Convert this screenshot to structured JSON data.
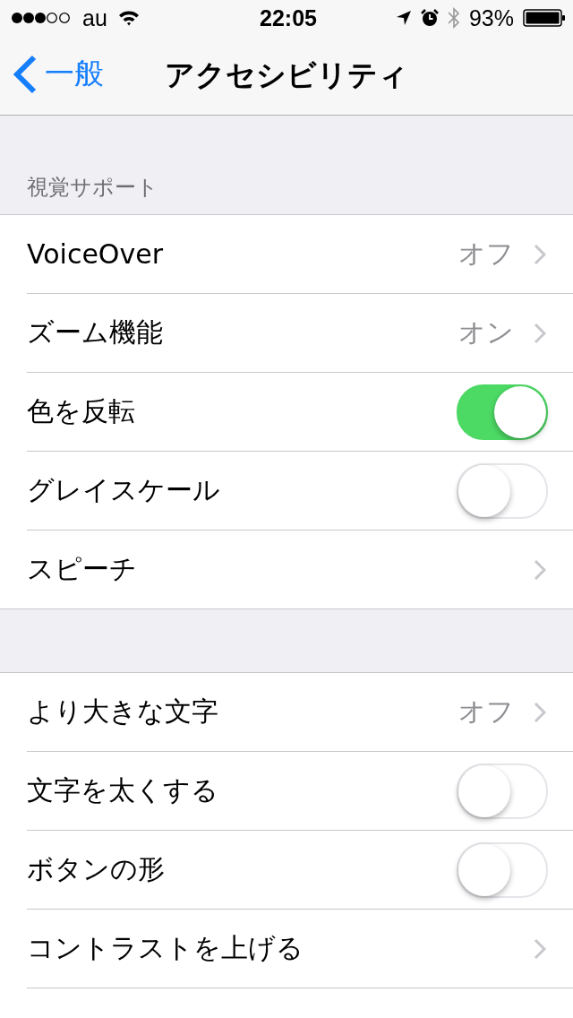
{
  "status_bar": {
    "carrier": "au",
    "time": "22:05",
    "battery": "93%"
  },
  "nav": {
    "back": "一般",
    "title": "アクセシビリティ"
  },
  "groups": [
    {
      "header": "視覚サポート",
      "rows": [
        {
          "kind": "link",
          "label": "VoiceOver",
          "value": "オフ"
        },
        {
          "kind": "link",
          "label": "ズーム機能",
          "value": "オン"
        },
        {
          "kind": "toggle",
          "label": "色を反転",
          "on": true
        },
        {
          "kind": "toggle",
          "label": "グレイスケール",
          "on": false
        },
        {
          "kind": "link",
          "label": "スピーチ"
        }
      ]
    },
    {
      "rows": [
        {
          "kind": "link",
          "label": "より大きな文字",
          "value": "オフ"
        },
        {
          "kind": "toggle",
          "label": "文字を太くする",
          "on": false
        },
        {
          "kind": "toggle",
          "label": "ボタンの形",
          "on": false
        },
        {
          "kind": "link",
          "label": "コントラストを上げる"
        }
      ]
    }
  ]
}
